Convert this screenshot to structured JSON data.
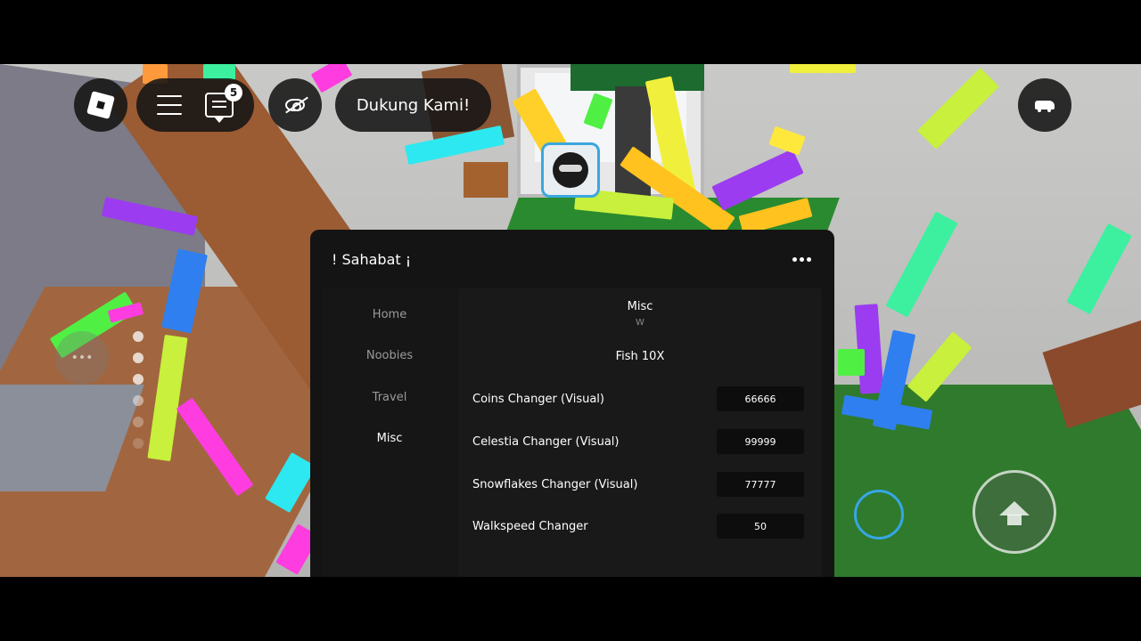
{
  "hud": {
    "chat_badge": "5",
    "support_label": "Dukung Kami!"
  },
  "window": {
    "title": "! Sahabat ¡",
    "nav": [
      {
        "label": "Home",
        "active": false
      },
      {
        "label": "Noobies",
        "active": false
      },
      {
        "label": "Travel",
        "active": false
      },
      {
        "label": "Misc",
        "active": true
      }
    ],
    "section": {
      "title": "Misc",
      "subtitle": "W",
      "button_label": "Fish 10X"
    },
    "fields": [
      {
        "label": "Coins Changer (Visual)",
        "value": "66666"
      },
      {
        "label": "Celestia Changer (Visual)",
        "value": "99999"
      },
      {
        "label": "Snowflakes Changer (Visual)",
        "value": "77777"
      },
      {
        "label": "Walkspeed Changer",
        "value": "50"
      }
    ]
  },
  "icons": {
    "menu": "hamburger-icon",
    "chat": "chat-icon",
    "visibility": "eye-off-icon",
    "vehicle": "car-icon",
    "options": "more-dots-icon",
    "jump": "arrow-up-icon"
  }
}
